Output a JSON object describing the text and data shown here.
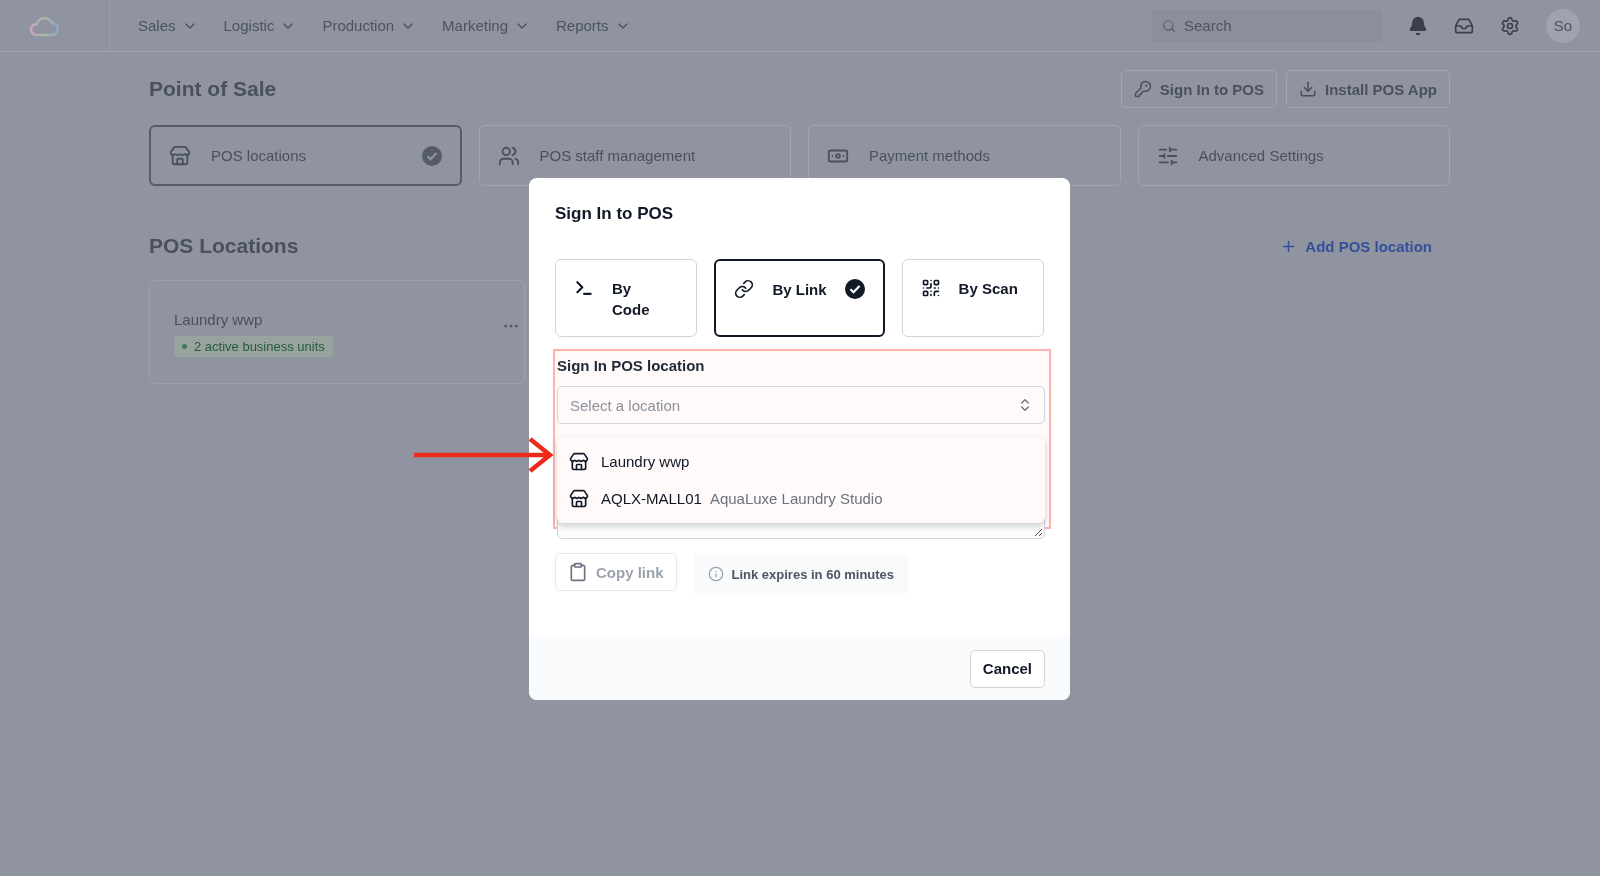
{
  "nav": {
    "menus": [
      "Sales",
      "Logistic",
      "Production",
      "Marketing",
      "Reports"
    ],
    "search": {
      "placeholder": "Search"
    },
    "avatar": "So"
  },
  "page": {
    "title": "Point of Sale",
    "actions": [
      {
        "kind": "key",
        "label": "Sign In to POS"
      },
      {
        "kind": "download",
        "label": "Install POS App"
      }
    ],
    "tabs": [
      {
        "kind": "store",
        "label": "POS locations",
        "selected": true
      },
      {
        "kind": "staff",
        "label": "POS staff management",
        "selected": false
      },
      {
        "kind": "payment",
        "label": "Payment methods",
        "selected": false
      },
      {
        "kind": "settings",
        "label": "Advanced Settings",
        "selected": false
      }
    ],
    "section_title": "POS Locations",
    "add_button": "Add POS location",
    "locations": [
      {
        "name": "Laundry wwp",
        "badge": "2 active business units"
      }
    ]
  },
  "modal": {
    "title": "Sign In to POS",
    "methods": [
      {
        "kind": "code",
        "label": "By\nCode",
        "selected": false
      },
      {
        "kind": "link",
        "label": "By Link",
        "selected": true
      },
      {
        "kind": "scan",
        "label": "By Scan",
        "selected": false
      }
    ],
    "field_label": "Sign In POS location",
    "select": {
      "placeholder": "Select a location"
    },
    "options": [
      {
        "name": "Laundry wwp"
      },
      {
        "name": "AQLX-MALL01",
        "detail": "AquaLuxe Laundry Studio"
      }
    ],
    "copy_button": "Copy link",
    "info": "Link expires in 60 minutes",
    "cancel": "Cancel"
  }
}
